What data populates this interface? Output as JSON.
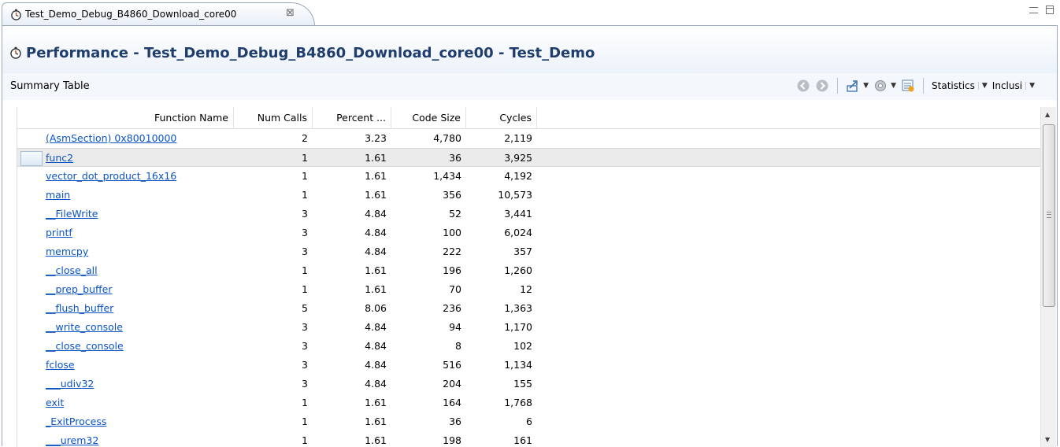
{
  "tab": {
    "title": "Test_Demo_Debug_B4860_Download_core00",
    "close_glyph": "⊠"
  },
  "header": {
    "title": "Performance - Test_Demo_Debug_B4860_Download_core00 - Test_Demo"
  },
  "summary": {
    "label": "Summary Table"
  },
  "toolbar": {
    "icons": [
      "back-icon",
      "forward-icon",
      "export-icon",
      "settings-gear-icon",
      "report-icon"
    ],
    "view_combo": "Statistics",
    "mode_combo": "Inclusi"
  },
  "table": {
    "columns": [
      "Function Name",
      "Num Calls",
      "Percent ...",
      "Code Size",
      "Cycles"
    ],
    "rows": [
      [
        "(AsmSection) 0x80010000",
        "2",
        "3.23",
        "4,780",
        "2,119"
      ],
      [
        "func2",
        "1",
        "1.61",
        "36",
        "3,925"
      ],
      [
        "vector_dot_product_16x16",
        "1",
        "1.61",
        "1,434",
        "4,192"
      ],
      [
        "main",
        "1",
        "1.61",
        "356",
        "10,573"
      ],
      [
        "__FileWrite",
        "3",
        "4.84",
        "52",
        "3,441"
      ],
      [
        "printf",
        "3",
        "4.84",
        "100",
        "6,024"
      ],
      [
        "memcpy",
        "3",
        "4.84",
        "222",
        "357"
      ],
      [
        "__close_all",
        "1",
        "1.61",
        "196",
        "1,260"
      ],
      [
        "__prep_buffer",
        "1",
        "1.61",
        "70",
        "12"
      ],
      [
        "__flush_buffer",
        "5",
        "8.06",
        "236",
        "1,363"
      ],
      [
        "__write_console",
        "3",
        "4.84",
        "94",
        "1,170"
      ],
      [
        "__close_console",
        "3",
        "4.84",
        "8",
        "102"
      ],
      [
        "fclose",
        "3",
        "4.84",
        "516",
        "1,134"
      ],
      [
        "___udiv32",
        "3",
        "4.84",
        "204",
        "155"
      ],
      [
        "exit",
        "1",
        "1.61",
        "164",
        "1,768"
      ],
      [
        "_ExitProcess",
        "1",
        "1.61",
        "36",
        "6"
      ],
      [
        "___urem32",
        "1",
        "1.61",
        "198",
        "161"
      ]
    ],
    "selected_row": 1
  },
  "colors": {
    "title": "#1f3d6d",
    "link": "#0b54c3",
    "selection": "#ebebeb"
  }
}
